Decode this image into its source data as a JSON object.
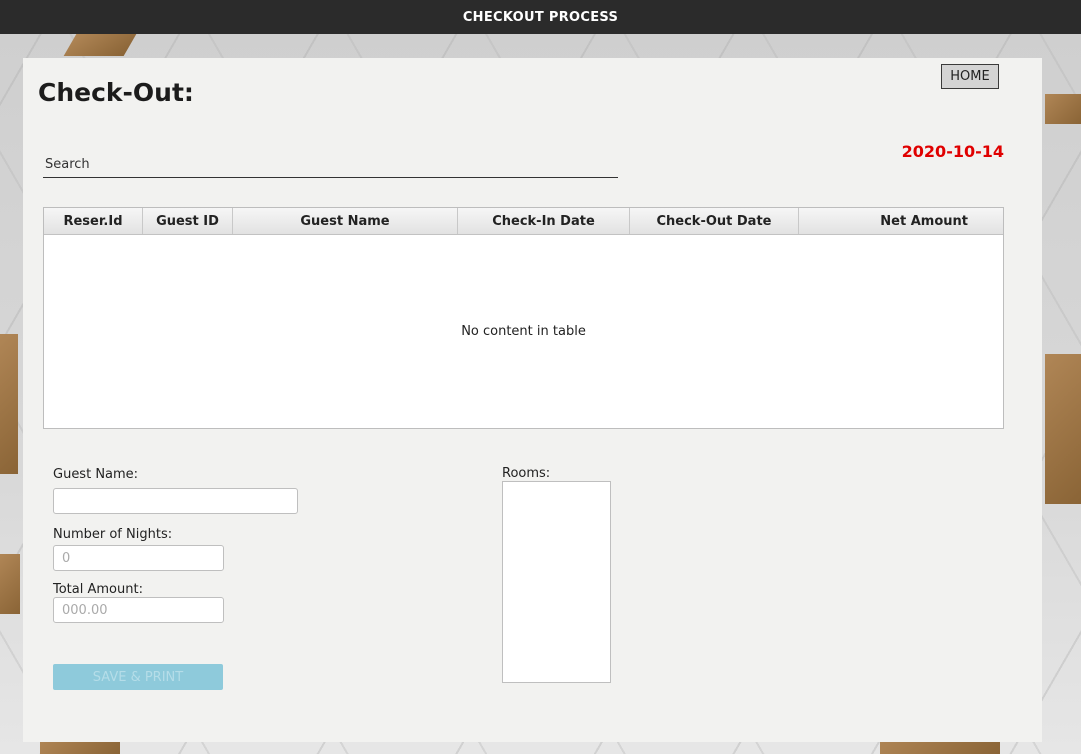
{
  "window": {
    "title": "CHECKOUT PROCESS"
  },
  "header": {
    "title": "Check-Out:",
    "home_label": "HOME",
    "date": "2020-10-14"
  },
  "search": {
    "placeholder": "Search"
  },
  "table": {
    "columns": [
      "Reser.Id",
      "Guest ID",
      "Guest Name",
      "Check-In Date",
      "Check-Out Date",
      "Net Amount"
    ],
    "rows": [],
    "empty_message": "No content in table"
  },
  "form": {
    "guest_name_label": "Guest Name:",
    "guest_name_value": "",
    "nights_label": "Number of Nights:",
    "nights_placeholder": "0",
    "total_label": "Total Amount:",
    "total_placeholder": "000.00",
    "save_label": "SAVE & PRINT",
    "rooms_label": "Rooms:",
    "rooms": []
  },
  "colors": {
    "date": "#e00000",
    "save_button": "#8ecadb",
    "titlebar": "#2b2b2b"
  }
}
